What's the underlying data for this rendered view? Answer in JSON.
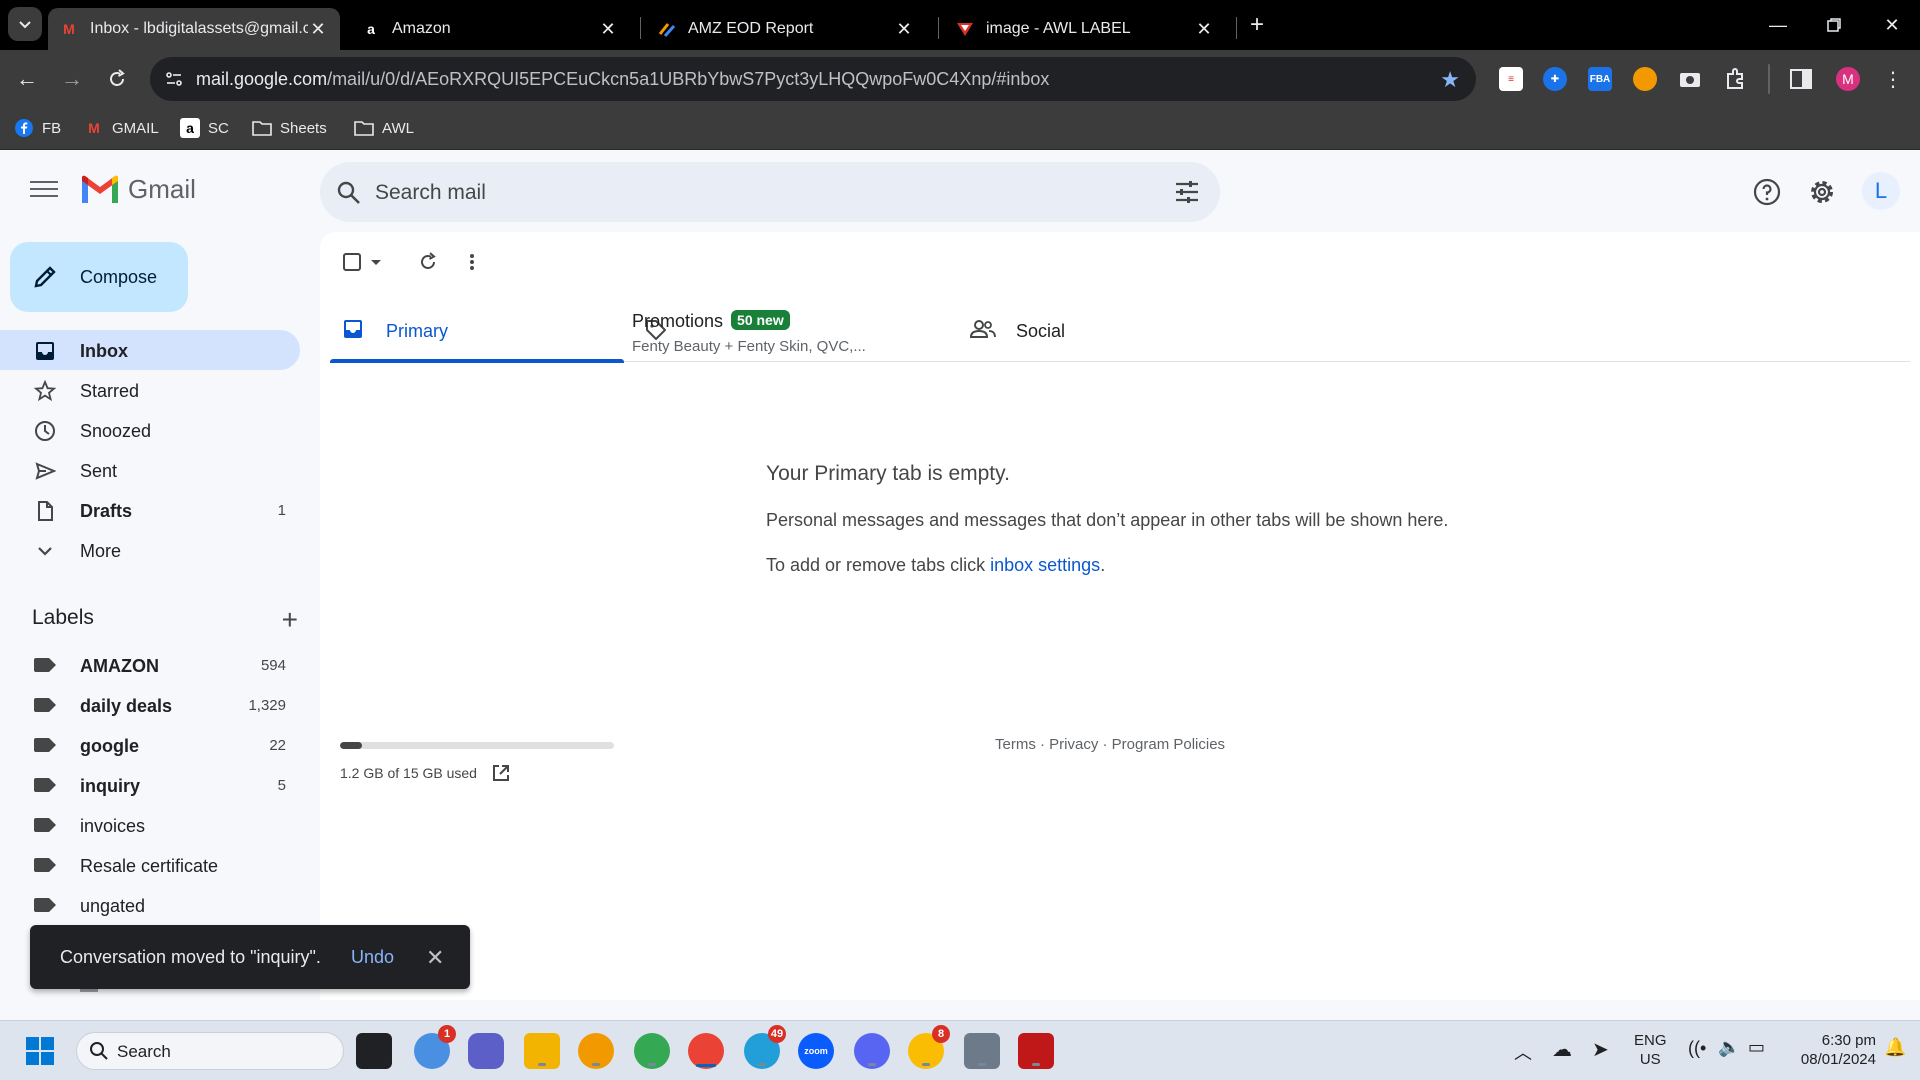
{
  "browser": {
    "tabs": [
      {
        "title": "Inbox - lbdigitalassets@gmail.com",
        "favicon": "gmail",
        "active": true
      },
      {
        "title": "Amazon",
        "favicon": "amazon",
        "active": false
      },
      {
        "title": "AMZ EOD Report",
        "favicon": "report",
        "active": false
      },
      {
        "title": "image - AWL LABEL",
        "favicon": "awl",
        "active": false
      }
    ],
    "url_host": "mail.google.com",
    "url_path": "/mail/u/0/d/AEoRXRQUI5EPCEuCkcn5a1UBRbYbwS7Pyct3yLHQQwpoFw0C4Xnp/#inbox",
    "profile_initial": "M",
    "bookmarks": [
      {
        "label": "FB",
        "icon": "facebook-icon"
      },
      {
        "label": "GMAIL",
        "icon": "gmail-icon"
      },
      {
        "label": "SC",
        "icon": "amazon-icon"
      },
      {
        "label": "Sheets",
        "icon": "folder-icon"
      },
      {
        "label": "AWL",
        "icon": "folder-icon"
      }
    ]
  },
  "gmail": {
    "wordmark": "Gmail",
    "search_placeholder": "Search mail",
    "avatar_initial": "L",
    "compose": "Compose",
    "nav": [
      {
        "label": "Inbox",
        "count": "",
        "active": true,
        "bold": true,
        "icon": "inbox-icon"
      },
      {
        "label": "Starred",
        "count": "",
        "active": false,
        "bold": false,
        "icon": "star-icon"
      },
      {
        "label": "Snoozed",
        "count": "",
        "active": false,
        "bold": false,
        "icon": "clock-icon"
      },
      {
        "label": "Sent",
        "count": "",
        "active": false,
        "bold": false,
        "icon": "send-icon"
      },
      {
        "label": "Drafts",
        "count": "1",
        "active": false,
        "bold": true,
        "icon": "draft-icon"
      },
      {
        "label": "More",
        "count": "",
        "active": false,
        "bold": false,
        "icon": "chevron-down-icon"
      }
    ],
    "labels_heading": "Labels",
    "labels": [
      {
        "label": "AMAZON",
        "count": "594",
        "bold": true
      },
      {
        "label": "daily deals",
        "count": "1,329",
        "bold": true
      },
      {
        "label": "google",
        "count": "22",
        "bold": true
      },
      {
        "label": "inquiry",
        "count": "5",
        "bold": true
      },
      {
        "label": "invoices",
        "count": "",
        "bold": false
      },
      {
        "label": "Resale certificate",
        "count": "",
        "bold": false
      },
      {
        "label": "ungated",
        "count": "",
        "bold": false
      }
    ],
    "inbox_tabs": {
      "primary": "Primary",
      "promotions": "Promotions",
      "promotions_badge": "50 new",
      "promotions_sub": "Fenty Beauty + Fenty Skin, QVC,...",
      "social": "Social"
    },
    "empty": {
      "title": "Your Primary tab is empty.",
      "body": "Personal messages and messages that don’t appear in other tabs will be shown here.",
      "settings_prefix": "To add or remove tabs click ",
      "settings_link": "inbox settings",
      "settings_suffix": "."
    },
    "storage": {
      "text": "1.2 GB of 15 GB used",
      "used_fraction": 0.08
    },
    "footer": "Terms · Privacy · Program Policies",
    "snackbar": {
      "message": "Conversation moved to \"inquiry\".",
      "action": "Undo"
    }
  },
  "taskbar": {
    "search_placeholder": "Search",
    "lang_line1": "ENG",
    "lang_line2": "US",
    "time": "6:30 pm",
    "date": "08/01/2024",
    "badges": {
      "weather": "1",
      "telegram": "49",
      "chrome2": "8"
    }
  },
  "colors": {
    "gmail_red": "#ea4335",
    "active_blue": "#0b57d0",
    "compose_bg": "#c2e7ff",
    "nav_active": "#d3e3fd",
    "promo_badge": "#188038"
  }
}
